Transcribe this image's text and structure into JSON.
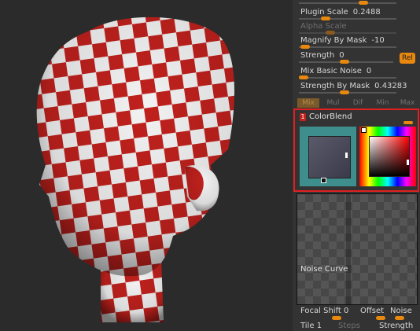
{
  "viewport": {
    "subject": "head-model",
    "colors": {
      "red": "#c0211d",
      "white": "#f2f2f2"
    }
  },
  "panel": {
    "sliders": [
      {
        "label": "Plugin Scale",
        "value": "0.2488",
        "active": true
      },
      {
        "label": "Alpha Scale",
        "value": "",
        "active": false
      },
      {
        "label": "Magnify By Mask",
        "value": "-10",
        "active": true
      },
      {
        "label": "Strength",
        "value": "0",
        "active": true
      },
      {
        "label": "Mix Basic Noise",
        "value": "0",
        "active": true
      },
      {
        "label": "Strength By Mask",
        "value": "0.43283",
        "active": true
      }
    ],
    "rel_button": "Rel",
    "modes": [
      "Mix",
      "Mul",
      "Dif",
      "Min",
      "Max"
    ],
    "colorblend": {
      "index": "1",
      "title": "ColorBlend"
    },
    "noise_curve_label": "Noise Curve",
    "bottom": {
      "focal_shift_label": "Focal Shift",
      "focal_shift_value": "0",
      "offset_label": "Offset",
      "noise_label": "Noise",
      "tile_label": "Tile",
      "tile_value": "1",
      "steps_label": "Steps",
      "strength_label": "Strength"
    }
  },
  "accent_color": "#e8880e"
}
